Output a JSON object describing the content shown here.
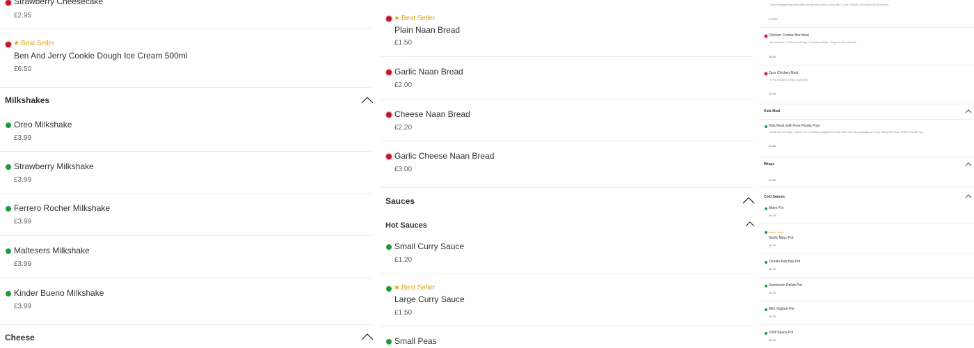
{
  "col1": {
    "item_cheesecake": {
      "name": "Strawberry Cheesecake",
      "price": "£2.95"
    },
    "item_benjerry": {
      "badge": "Best Seller",
      "name": "Ben And Jerry Cookie Dough Ice Cream 500ml",
      "price": "£6.50"
    },
    "milkshakes_title": "Milkshakes",
    "milkshakes": [
      {
        "name": "Oreo Milkshake",
        "price": "£3.99"
      },
      {
        "name": "Strawberry Milkshake",
        "price": "£3.99"
      },
      {
        "name": "Ferrero Rocher Milkshake",
        "price": "£3.99"
      },
      {
        "name": "Maltesers Milkshake",
        "price": "£3.99"
      },
      {
        "name": "Kinder Bueno Milkshake",
        "price": "£3.99"
      }
    ],
    "cheese_title": "Cheese"
  },
  "col2": {
    "breads": [
      {
        "badge": "Best Seller",
        "name": "Plain Naan Bread",
        "price": "£1.50"
      },
      {
        "name": "Garlic Naan Bread",
        "price": "£2.00"
      },
      {
        "name": "Cheese Naan Bread",
        "price": "£2.20"
      },
      {
        "name": "Garlic Cheese Naan Bread",
        "price": "£3.00"
      }
    ],
    "sauces_title": "Sauces",
    "hot_sauces_title": "Hot Sauces",
    "hot_sauces": [
      {
        "name": "Small Curry Sauce",
        "price": "£1.20"
      },
      {
        "badge": "Best Seller",
        "name": "Large Curry Sauce",
        "price": "£1.50"
      },
      {
        "name": "Small Peas"
      }
    ]
  },
  "col3": {
    "top_item": {
      "desc": "12inch margherita pizza with donner and chips on top and a can of drink. Add salad for 50p extra.",
      "price": "£13.00"
    },
    "meals": [
      {
        "name": "Chicken Combo Box Meal",
        "desc": "1pc Chicken, 2 Pcs Hot Wings, 2 Chicken Strips, Chips & Can of Drink",
        "price": "£6.50"
      },
      {
        "name": "2pcs Chicken Meal",
        "desc": "2 Pcs chicken, Chips and Drink",
        "price": "£5.50"
      }
    ],
    "kids_title": "Kids Meal",
    "kids": {
      "name": "Kids Meal (with Free Panda Pop)",
      "desc": "Small tray of chips, Popcorn or 4 chicken nuggets OR fish cake OR mini sausage & Curry, Gravy Or Peas. FREE Panda Pop",
      "price": "£3.80"
    },
    "wraps_title": "Wraps",
    "wraps_price": "£1.50",
    "cold_sauces_title": "Cold Sauces",
    "cold_sauces": [
      {
        "name": "Mayo Pot",
        "price": "£0.70"
      },
      {
        "badge": "Best Seller",
        "name": "Garlic Mayo Pot",
        "price": "£0.70"
      },
      {
        "name": "Tomato Ketchup Pot",
        "price": "£0.70"
      },
      {
        "name": "Sweetcorn Relish Pot",
        "price": "£0.70"
      },
      {
        "name": "Mint Yoghurt Pot",
        "price": "£0.70"
      },
      {
        "name": "Chilli Sauce Pot",
        "price": "£0.70"
      }
    ]
  },
  "colors": {
    "veg": "#1a9c3a",
    "nonveg": "#c0162b",
    "best": "#e0a419",
    "text": "#2e3333"
  }
}
